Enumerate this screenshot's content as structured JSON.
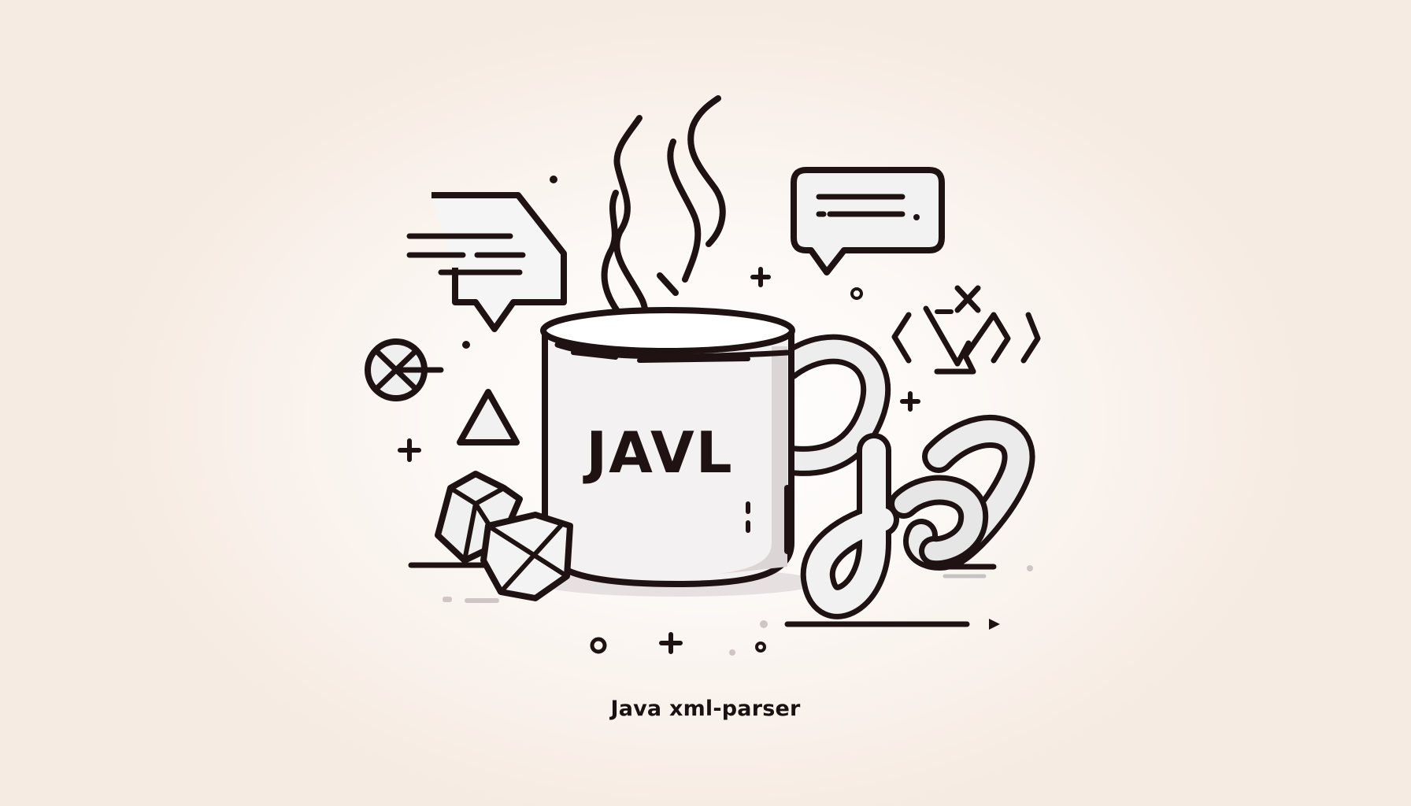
{
  "mug": {
    "label": "JAVL"
  },
  "caption": "Java xml-parser",
  "colors": {
    "background": "#f6ebe2",
    "ink": "#1e1212",
    "mug_fill": "#f3f1f1",
    "shadow": "#d9d2d2"
  },
  "icons": [
    "steam-icon",
    "coffee-mug-icon",
    "speech-bubble-icon",
    "chat-bubble-icon",
    "code-brackets-icon",
    "chain-link-icon",
    "crystal-icon",
    "triangle-icon",
    "pie-icon",
    "plus-icon"
  ]
}
